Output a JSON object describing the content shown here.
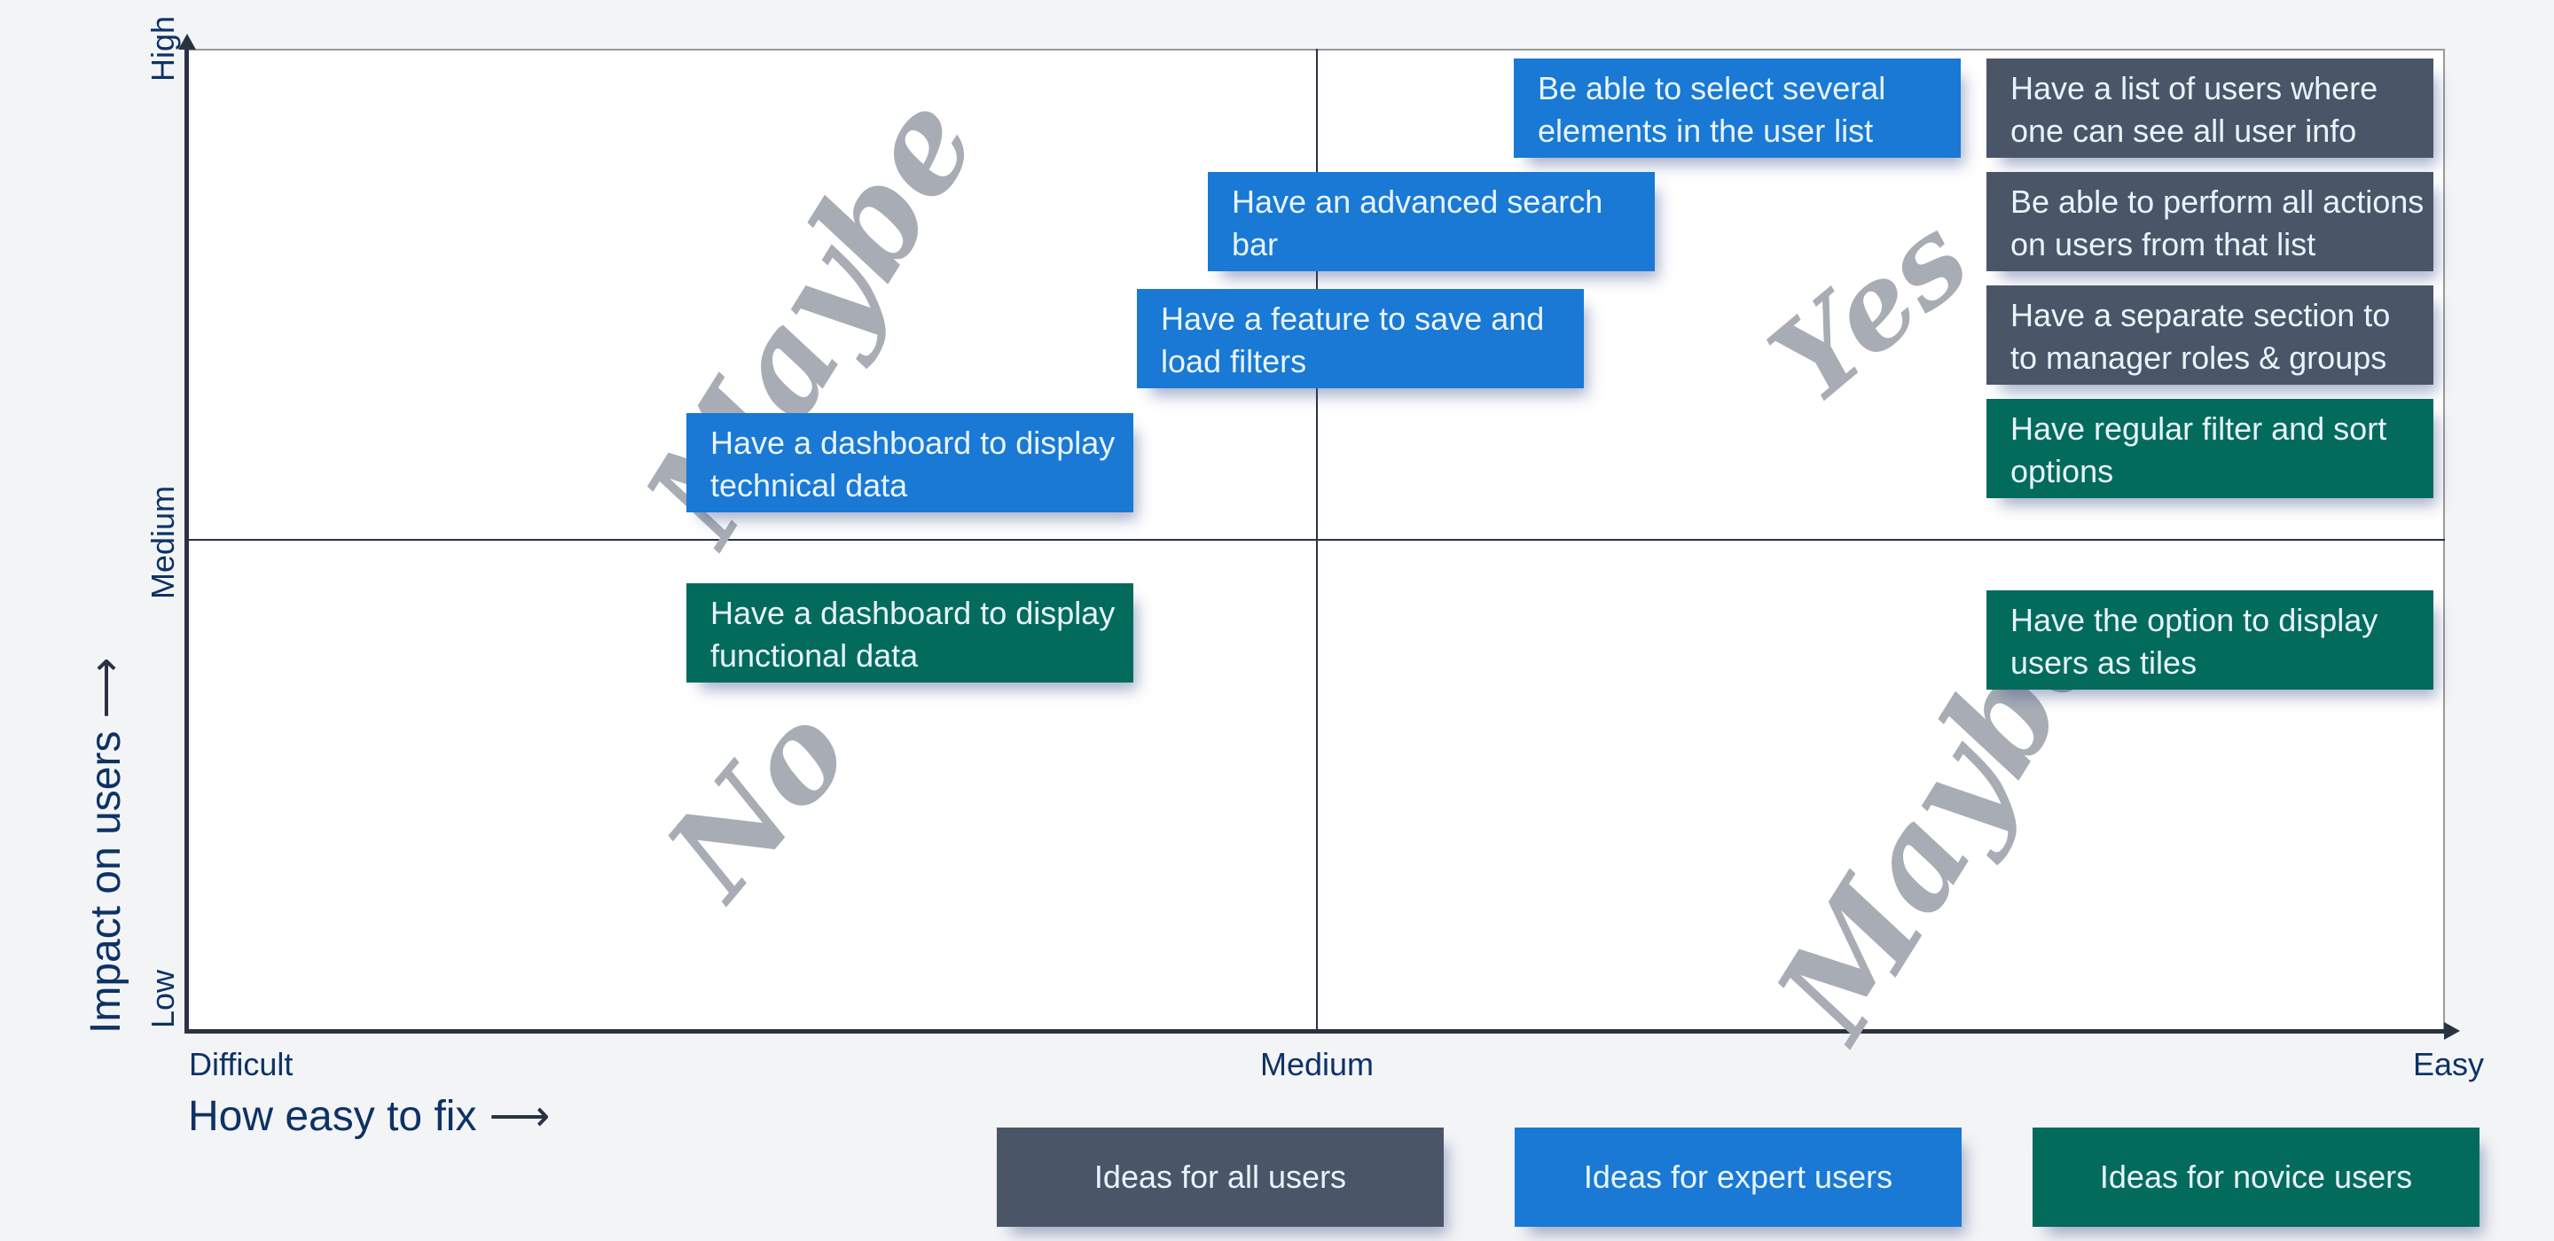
{
  "colors": {
    "all_users": "#4a5568",
    "expert_users": "#1979d4",
    "novice_users": "#036b5c",
    "axis_text": "#0d3266",
    "watermark": "#a8adb5"
  },
  "axes": {
    "x_title": "How easy to fix",
    "x_title_arrow": "⟶",
    "x_ticks": [
      "Difficult",
      "Medium",
      "Easy"
    ],
    "y_title": "Impact on users",
    "y_title_arrow": "⟶",
    "y_ticks": [
      "Low",
      "Medium",
      "High"
    ]
  },
  "quadrant_labels": {
    "top_left": "Maybe",
    "top_right": "Yes",
    "bottom_left": "No",
    "bottom_right": "Maybe"
  },
  "notes": [
    {
      "text": "Be able to select several elements in the user list",
      "group": "expert",
      "quadrant": "top-right"
    },
    {
      "text": "Have a list of users where one can see all user info",
      "group": "all",
      "quadrant": "top-right"
    },
    {
      "text": "Have an advanced search bar",
      "group": "expert",
      "quadrant": "top-center"
    },
    {
      "text": "Be able to perform all actions on users from that list",
      "group": "all",
      "quadrant": "top-right"
    },
    {
      "text": "Have a feature to save and load filters",
      "group": "expert",
      "quadrant": "top-center"
    },
    {
      "text": "Have a separate section to to manager roles & groups",
      "group": "all",
      "quadrant": "top-right"
    },
    {
      "text": "Have a dashboard to display technical data",
      "group": "expert",
      "quadrant": "top-left"
    },
    {
      "text": "Have regular filter and sort options",
      "group": "novice",
      "quadrant": "top-right"
    },
    {
      "text": "Have a dashboard to display functional data",
      "group": "novice",
      "quadrant": "bottom-left"
    },
    {
      "text": "Have the option to display users as tiles",
      "group": "novice",
      "quadrant": "bottom-right"
    }
  ],
  "legend": [
    {
      "label": "Ideas for all users",
      "group": "all"
    },
    {
      "label": "Ideas for expert users",
      "group": "expert"
    },
    {
      "label": "Ideas for novice users",
      "group": "novice"
    }
  ]
}
